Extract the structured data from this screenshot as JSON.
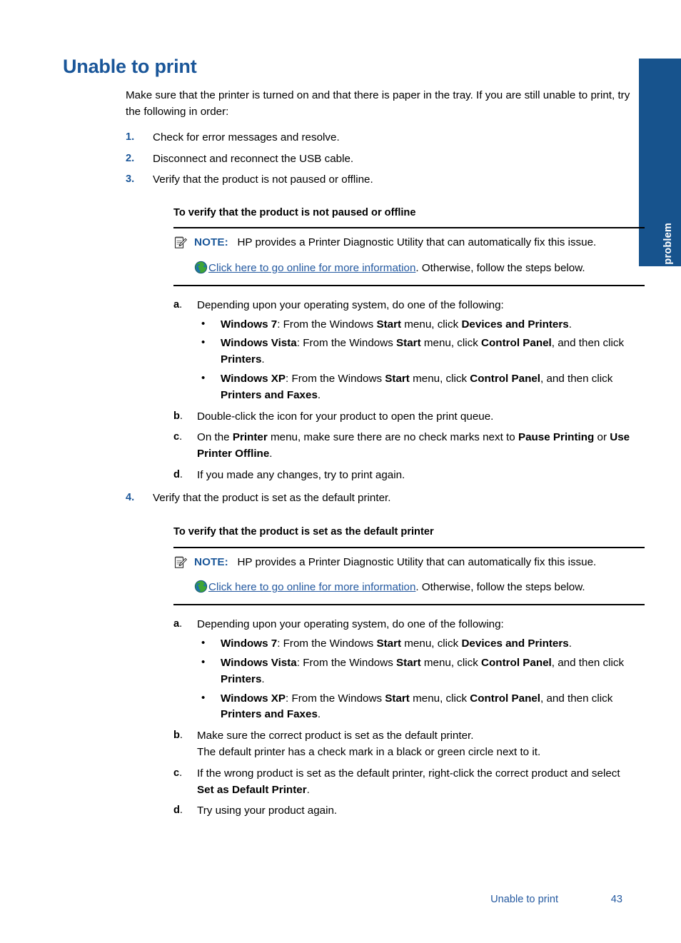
{
  "page": {
    "title": "Unable to print",
    "intro": "Make sure that the printer is turned on and that there is paper in the tray. If you are still unable to print, try the following in order:",
    "side_tab_label": "Solve a problem",
    "accent_blue": "#1a5699",
    "tab_blue": "#17538d",
    "link_blue": "#2459a0"
  },
  "steps": [
    {
      "num": "1.",
      "text": "Check for error messages and resolve."
    },
    {
      "num": "2.",
      "text": "Disconnect and reconnect the USB cable."
    },
    {
      "num": "3.",
      "text": "Verify that the product is not paused or offline."
    },
    {
      "num": "4.",
      "text": "Verify that the product is set as the default printer."
    }
  ],
  "procedure_1": {
    "heading": "To verify that the product is not paused or offline",
    "note": {
      "icon": "note-pencil-icon",
      "label": "NOTE:",
      "text": "HP provides a Printer Diagnostic Utility that can automatically fix this issue.",
      "link_icon": "globe-icon",
      "link_text": "Click here to go online for more information",
      "after_link": ". Otherwise, follow the steps below."
    },
    "items": [
      {
        "alpha": "a",
        "text": "Depending upon your operating system, do one of the following:",
        "bullets": [
          {
            "os": "Windows 7",
            "pre": ": From the Windows ",
            "kw1": "Start",
            "mid": " menu, click ",
            "kw2": "Devices and Printers",
            "post": "."
          },
          {
            "os": "Windows Vista",
            "pre": ": From the Windows ",
            "kw1": "Start",
            "mid": " menu, click ",
            "kw2": "Control Panel",
            "post": ", and then click ",
            "kw3": "Printers",
            "tail": "."
          },
          {
            "os": "Windows XP",
            "pre": ": From the Windows ",
            "kw1": "Start",
            "mid": " menu, click ",
            "kw2": "Control Panel",
            "post": ", and then click ",
            "kw3": "Printers and Faxes",
            "tail": "."
          }
        ]
      },
      {
        "alpha": "b",
        "text": "Double-click the icon for your product to open the print queue."
      },
      {
        "alpha": "c",
        "pre": "On the ",
        "kw1": "Printer",
        "mid": " menu, make sure there are no check marks next to ",
        "kw2": "Pause Printing",
        "post": " or ",
        "kw3": "Use Printer Offline",
        "tail": "."
      },
      {
        "alpha": "d",
        "text": "If you made any changes, try to print again."
      }
    ]
  },
  "procedure_2": {
    "heading": "To verify that the product is set as the default printer",
    "note": {
      "icon": "note-pencil-icon",
      "label": "NOTE:",
      "text": "HP provides a Printer Diagnostic Utility that can automatically fix this issue.",
      "link_icon": "globe-icon",
      "link_text": "Click here to go online for more information",
      "after_link": ". Otherwise, follow the steps below."
    },
    "items": [
      {
        "alpha": "a",
        "text": "Depending upon your operating system, do one of the following:",
        "bullets": [
          {
            "os": "Windows 7",
            "pre": ": From the Windows ",
            "kw1": "Start",
            "mid": " menu, click ",
            "kw2": "Devices and Printers",
            "post": "."
          },
          {
            "os": "Windows Vista",
            "pre": ": From the Windows ",
            "kw1": "Start",
            "mid": " menu, click ",
            "kw2": "Control Panel",
            "post": ", and then click ",
            "kw3": "Printers",
            "tail": "."
          },
          {
            "os": "Windows XP",
            "pre": ": From the Windows ",
            "kw1": "Start",
            "mid": " menu, click ",
            "kw2": "Control Panel",
            "post": ", and then click ",
            "kw3": "Printers and Faxes",
            "tail": "."
          }
        ]
      },
      {
        "alpha": "b",
        "text": "Make sure the correct product is set as the default printer.",
        "subtext": "The default printer has a check mark in a black or green circle next to it."
      },
      {
        "alpha": "c",
        "pre": "If the wrong product is set as the default printer, right-click the correct product and select ",
        "kw1": "Set as Default Printer",
        "tail": "."
      },
      {
        "alpha": "d",
        "text": "Try using your product again."
      }
    ]
  },
  "footer": {
    "title": "Unable to print",
    "page_number": "43"
  }
}
